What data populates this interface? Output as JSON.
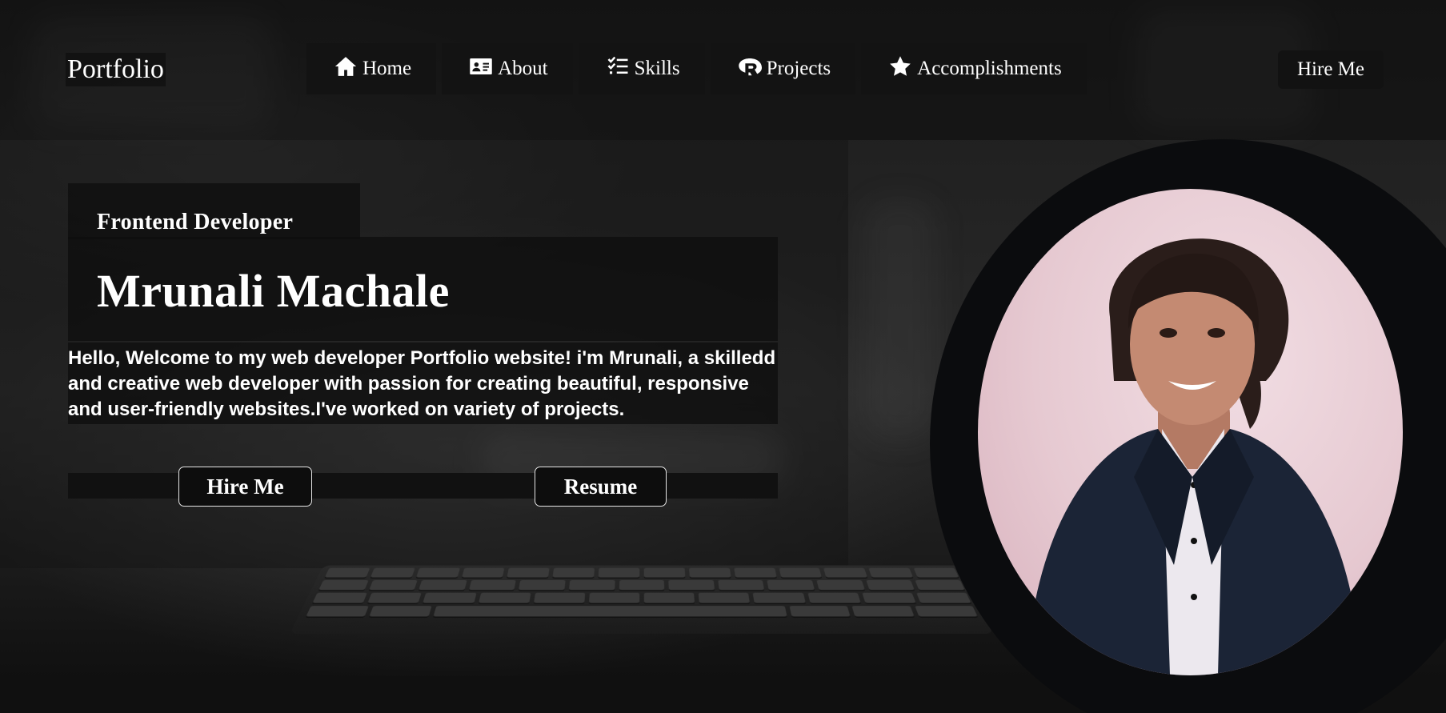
{
  "logo": "Portfolio",
  "nav": {
    "items": [
      {
        "label": "Home",
        "icon": "home-icon"
      },
      {
        "label": "About",
        "icon": "id-card-icon"
      },
      {
        "label": "Skills",
        "icon": "checklist-icon"
      },
      {
        "label": "Projects",
        "icon": "r-project-icon"
      },
      {
        "label": "Accomplishments",
        "icon": "star-icon"
      }
    ],
    "hire_label": "Hire Me"
  },
  "hero": {
    "role": "Frontend Developer",
    "name": "Mrunali Machale",
    "intro": "Hello, Welcome to my web developer Portfolio website! i'm Mrunali, a skilledd and creative web developer with passion for creating beautiful, responsive and user-friendly websites.I've worked on variety of projects.",
    "hire_button": "Hire Me",
    "resume_button": "Resume"
  },
  "colors": {
    "background": "#1a1a1a",
    "text": "#ffffff",
    "nav_item_bg": "#131313",
    "photo_bg": "#e6c9d1"
  }
}
